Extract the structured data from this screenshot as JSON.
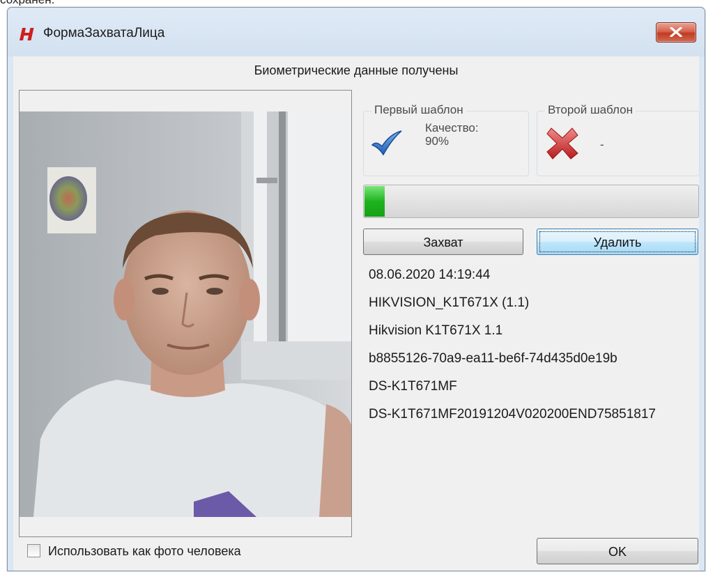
{
  "top_fragment": "сохранен.",
  "window": {
    "title": "ФормаЗахватаЛица",
    "logo_letter": "H",
    "logo_color": "#cc1f1f"
  },
  "status_text": "Биометрические данные получены",
  "template1": {
    "title": "Первый шаблон",
    "icon": "check-icon",
    "quality_label": "Качество:",
    "quality_value": "90%"
  },
  "template2": {
    "title": "Второй шаблон",
    "icon": "x-icon",
    "value": "-"
  },
  "progress": {
    "fraction": 0.06,
    "color": "#1fb41f"
  },
  "buttons": {
    "capture": "Захват",
    "delete": "Удалить",
    "ok": "OK"
  },
  "info": [
    "08.06.2020 14:19:44",
    "HIKVISION_K1T671X (1.1)",
    "Hikvision K1T671X 1.1",
    "b8855126-70a9-ea11-be6f-74d435d0e19b",
    "DS-K1T671MF",
    "DS-K1T671MF20191204V020200END75851817"
  ],
  "use_as_photo": {
    "label": "Использовать как фото человека",
    "checked": false
  }
}
